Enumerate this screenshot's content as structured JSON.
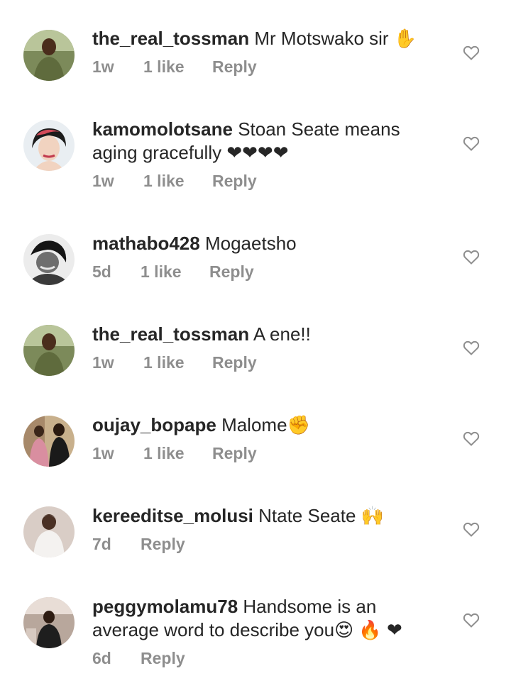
{
  "comments": [
    {
      "username": "the_real_tossman",
      "text": "Mr Motswako sir ✋",
      "time": "1w",
      "likes": "1 like",
      "reply": "Reply",
      "avatar": "avatar-green-shirt"
    },
    {
      "username": "kamomolotsane",
      "text": "Stoan Seate means aging gracefully ❤❤❤❤",
      "time": "1w",
      "likes": "1 like",
      "reply": "Reply",
      "avatar": "avatar-woman-red-hair"
    },
    {
      "username": "mathabo428",
      "text": "Mogaetsho",
      "time": "5d",
      "likes": "1 like",
      "reply": "Reply",
      "avatar": "avatar-bw-woman"
    },
    {
      "username": "the_real_tossman",
      "text": "A ene!!",
      "time": "1w",
      "likes": "1 like",
      "reply": "Reply",
      "avatar": "avatar-green-shirt"
    },
    {
      "username": "oujay_bopape",
      "text": "Malome✊",
      "time": "1w",
      "likes": "1 like",
      "reply": "Reply",
      "avatar": "avatar-couple"
    },
    {
      "username": "kereeditse_molusi",
      "text": "Ntate Seate 🙌",
      "time": "7d",
      "likes": "",
      "reply": "Reply",
      "avatar": "avatar-woman-white-dress"
    },
    {
      "username": "peggymolamu78",
      "text": "Handsome is an average word to describe you😍 🔥 ❤",
      "time": "6d",
      "likes": "",
      "reply": "Reply",
      "avatar": "avatar-woman-sitting"
    }
  ],
  "colors": {
    "text": "#262626",
    "meta": "#8e8e8e",
    "heart_outline": "#8e8e8e",
    "emoji_heart": "#e02424"
  },
  "icons": {
    "like": "heart-outline-icon"
  }
}
